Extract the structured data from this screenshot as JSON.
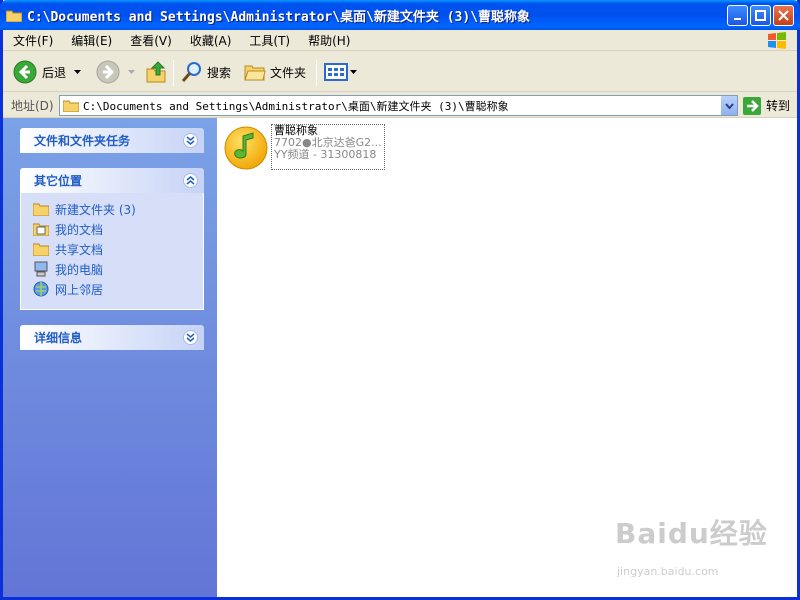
{
  "window": {
    "title": "C:\\Documents and Settings\\Administrator\\桌面\\新建文件夹 (3)\\曹聪称象"
  },
  "menu": [
    "文件(F)",
    "编辑(E)",
    "查看(V)",
    "收藏(A)",
    "工具(T)",
    "帮助(H)"
  ],
  "toolbar": {
    "back_label": "后退",
    "search_label": "搜索",
    "folders_label": "文件夹"
  },
  "address": {
    "label": "地址(D)",
    "value": "C:\\Documents and Settings\\Administrator\\桌面\\新建文件夹 (3)\\曹聪称象",
    "go_label": "转到"
  },
  "sidebar": {
    "tasks_title": "文件和文件夹任务",
    "other_title": "其它位置",
    "details_title": "详细信息",
    "places": [
      {
        "label": "新建文件夹 (3)",
        "icon": "folder-icon"
      },
      {
        "label": "我的文档",
        "icon": "my-documents-icon"
      },
      {
        "label": "共享文档",
        "icon": "shared-folder-icon"
      },
      {
        "label": "我的电脑",
        "icon": "my-computer-icon"
      },
      {
        "label": "网上邻居",
        "icon": "network-icon"
      }
    ]
  },
  "file": {
    "name": "曹聪称象",
    "line2": "7702●北京达爸G2...",
    "line3": "YY频道 - 31300818"
  },
  "watermark": {
    "brand": "Baidu经验",
    "url": "jingyan.baidu.com"
  },
  "colors": {
    "title_blue": "#0054e3",
    "task_pane": "#6f8ee0",
    "link_blue": "#215dc6"
  }
}
